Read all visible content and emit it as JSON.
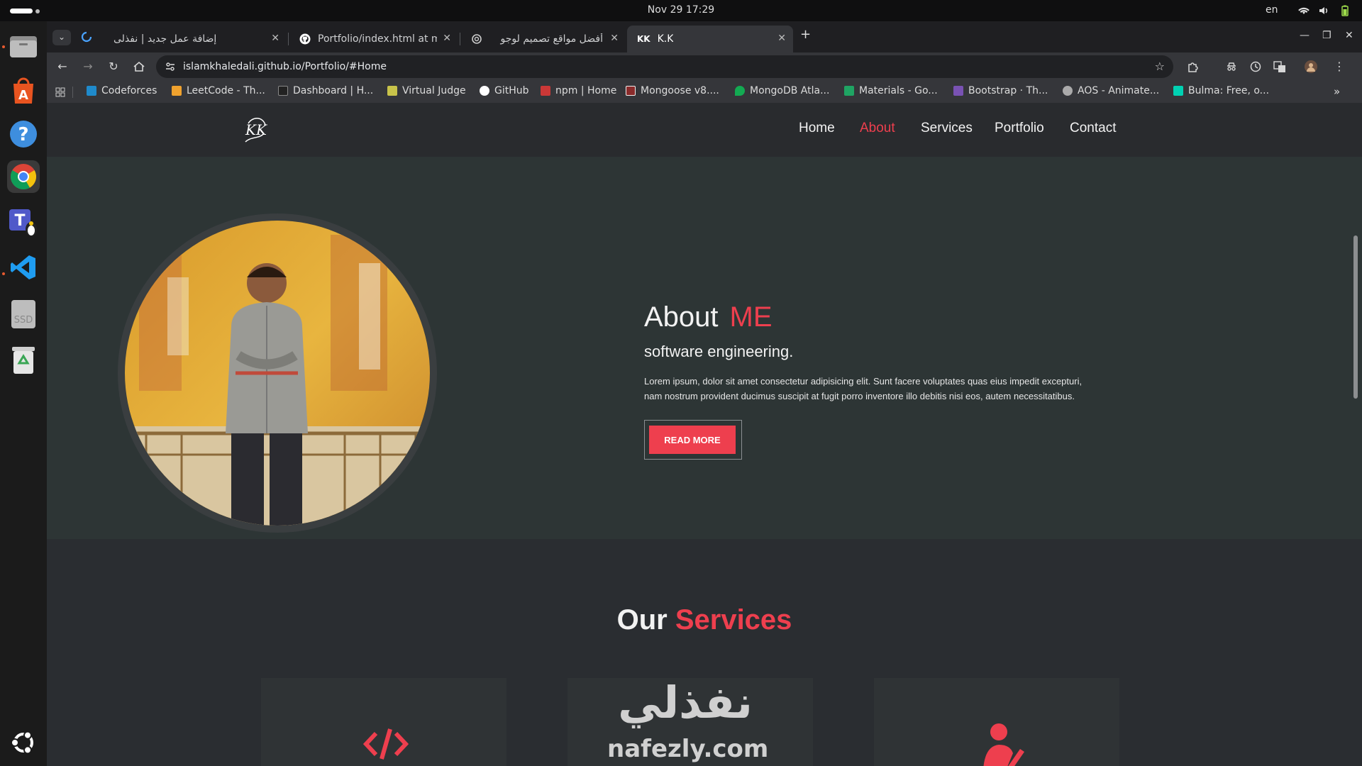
{
  "system": {
    "clock": "Nov 29  17:29",
    "lang": "en"
  },
  "dock": {
    "items": [
      "files-icon",
      "app-center-icon",
      "help-icon",
      "chrome-icon",
      "teams-linux-icon",
      "vscode-icon",
      "ssd-drive-icon",
      "trash-icon"
    ],
    "ssd_label": "SSD",
    "show_apps": "ubuntu-apps-icon"
  },
  "tabs": [
    {
      "title": "إضافة عمل جديد | نفذلى",
      "active": false
    },
    {
      "title": "Portfolio/index.html at m",
      "active": false
    },
    {
      "title": "أفضل مواقع تصميم لوجو",
      "active": false
    },
    {
      "title": "K.K",
      "active": true,
      "favicon_text": "KK"
    }
  ],
  "toolbar": {
    "url": "islamkhaledali.github.io/Portfolio/#Home"
  },
  "bookmarks": [
    {
      "label": "Codeforces",
      "color": "#1f8acb"
    },
    {
      "label": "LeetCode - Th...",
      "color": "#f0a22e"
    },
    {
      "label": "Dashboard | H...",
      "color": "#222222"
    },
    {
      "label": "Virtual Judge",
      "color": "#c8c34a"
    },
    {
      "label": "GitHub",
      "color": "#ffffff"
    },
    {
      "label": "npm | Home",
      "color": "#cb3837"
    },
    {
      "label": "Mongoose v8....",
      "color": "#8a2b2b"
    },
    {
      "label": "MongoDB Atla...",
      "color": "#13aa52"
    },
    {
      "label": "Materials - Go...",
      "color": "#1fa463"
    },
    {
      "label": "Bootstrap · Th...",
      "color": "#7952b3"
    },
    {
      "label": "AOS - Animate...",
      "color": "#aaaaaa"
    },
    {
      "label": "Bulma: Free, o...",
      "color": "#00d1b2"
    }
  ],
  "site": {
    "nav": [
      "Home",
      "About",
      "Services",
      "Portfolio",
      "Contact"
    ],
    "active_nav": "About",
    "about": {
      "title": "About",
      "title_accent": "ME",
      "subtitle": "software engineering.",
      "body": "Lorem ipsum, dolor sit amet consectetur adipisicing elit. Sunt facere voluptates quas eius impedit excepturi, nam nostrum provident ducimus suscipit at fugit porro inventore illo debitis nisi eos, autem necessitatibus.",
      "button": "READ MORE"
    },
    "services": {
      "title": "Our",
      "title_accent": "Services"
    },
    "watermark": {
      "arabic": "نفذلي",
      "latin": "nafezly.com"
    }
  },
  "colors": {
    "accent": "#ee3f4e",
    "page_bg": "#2a2d31",
    "about_bg": "#2d3535"
  }
}
